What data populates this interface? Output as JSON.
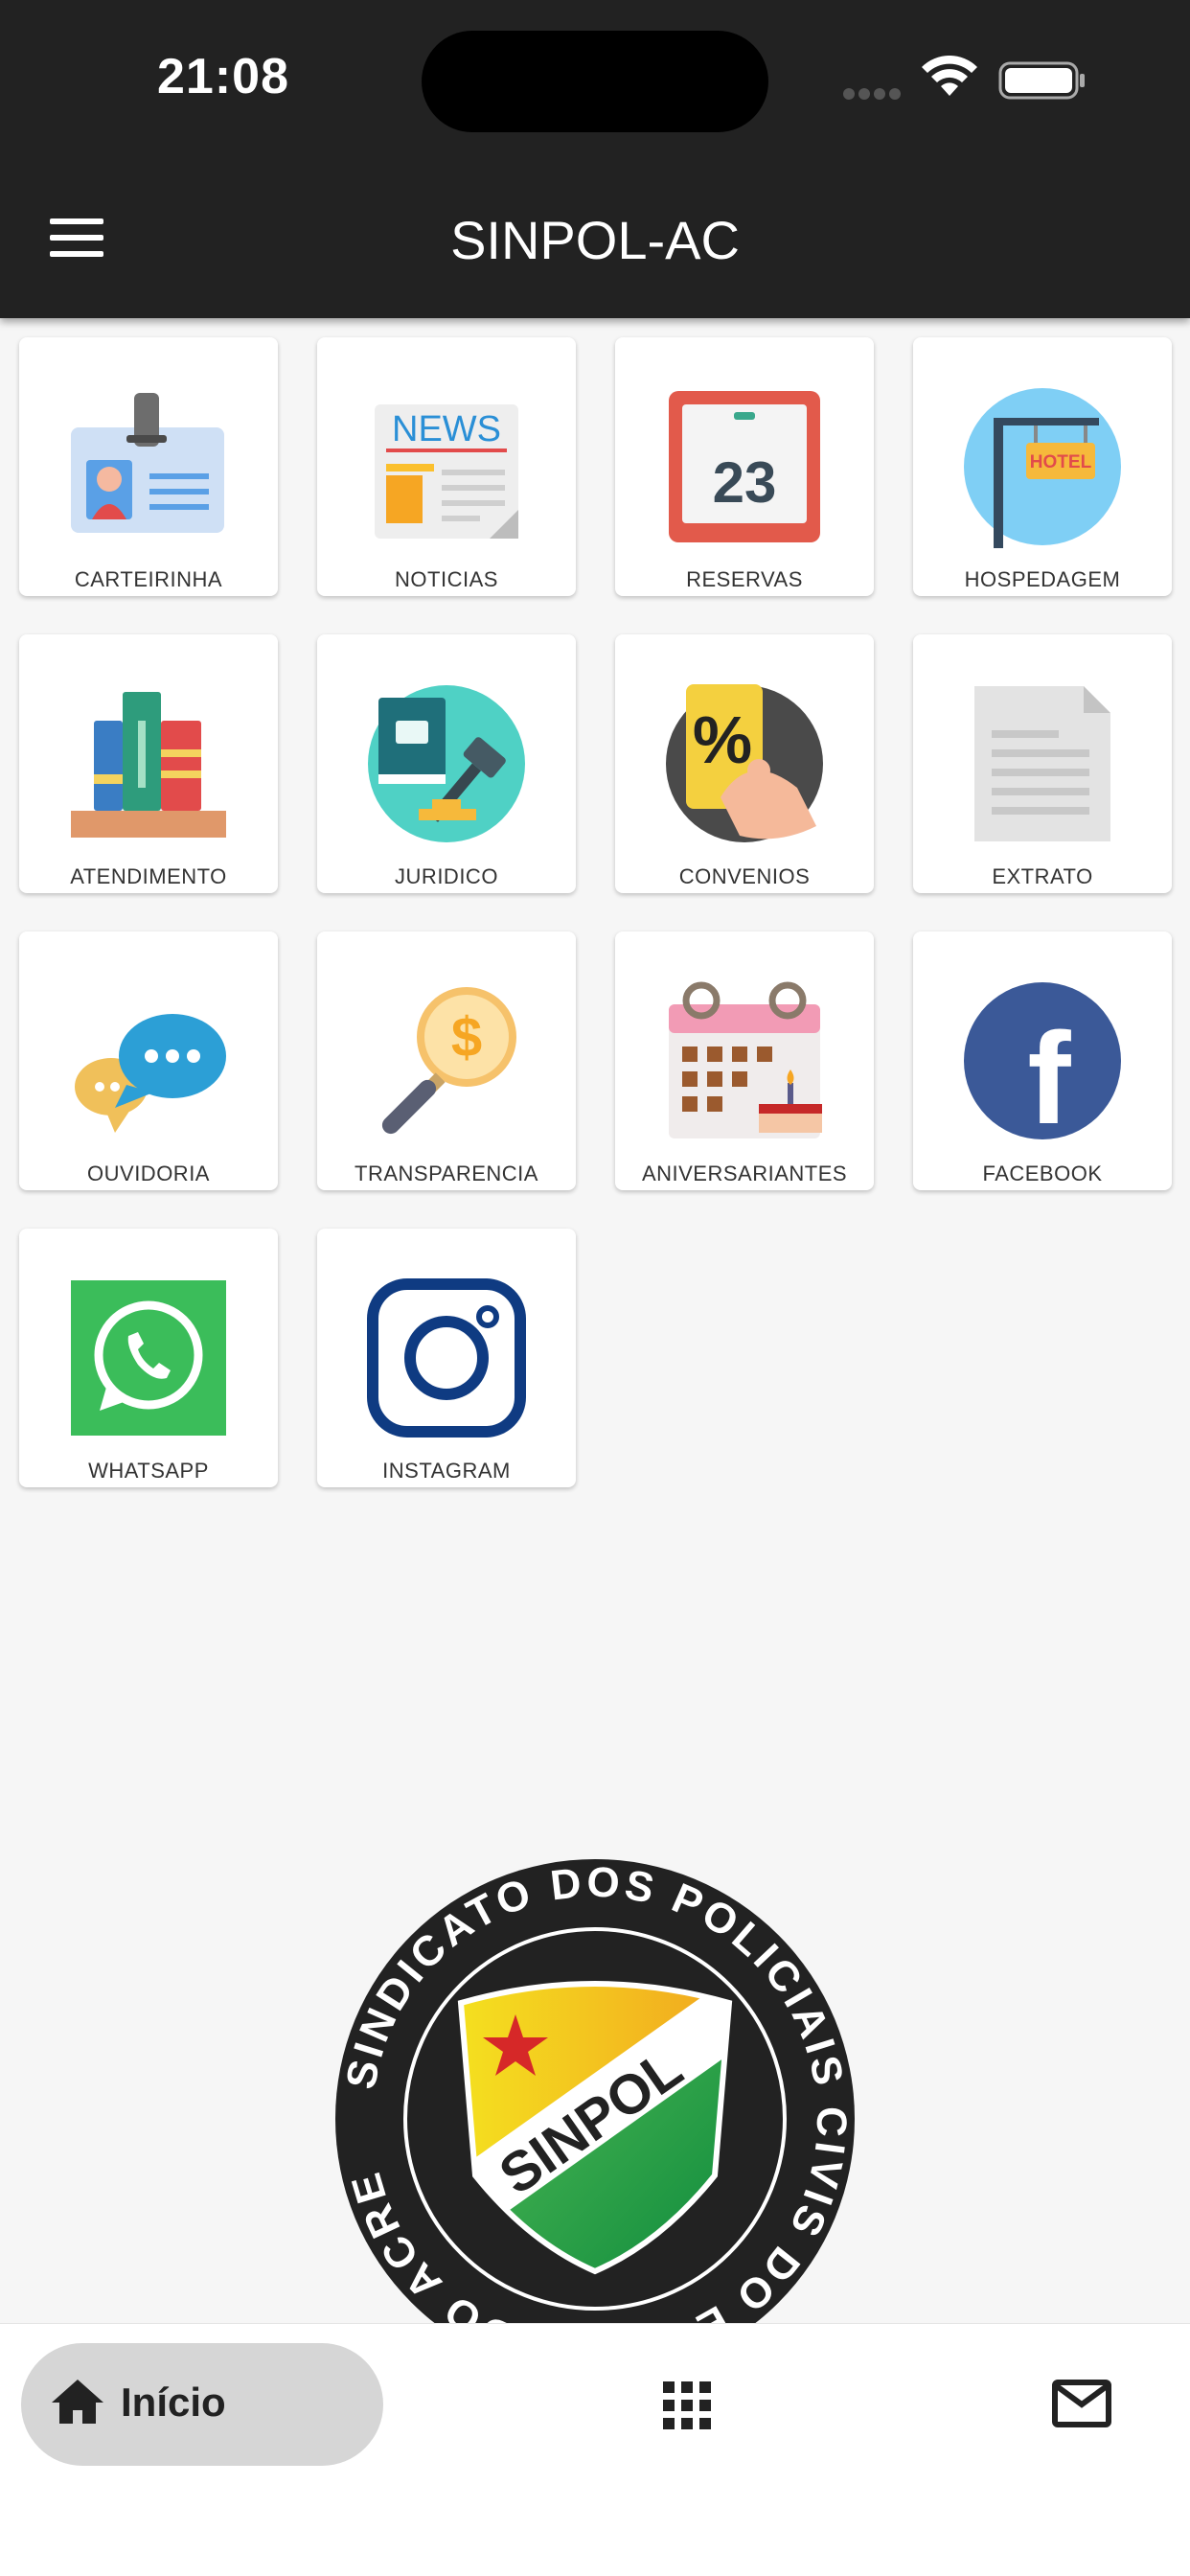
{
  "status_bar": {
    "time": "21:08"
  },
  "header": {
    "title": "SINPOL-AC"
  },
  "tiles": [
    {
      "label": "CARTEIRINHA",
      "icon": "id-card-icon"
    },
    {
      "label": "NOTICIAS",
      "icon": "newspaper-icon",
      "icon_text": "NEWS"
    },
    {
      "label": "RESERVAS",
      "icon": "calendar-icon",
      "icon_text": "23"
    },
    {
      "label": "HOSPEDAGEM",
      "icon": "hotel-sign-icon",
      "icon_text": "HOTEL"
    },
    {
      "label": "ATENDIMENTO",
      "icon": "books-icon"
    },
    {
      "label": "JURIDICO",
      "icon": "gavel-icon"
    },
    {
      "label": "CONVENIOS",
      "icon": "discount-card-icon",
      "icon_text": "%"
    },
    {
      "label": "EXTRATO",
      "icon": "document-icon"
    },
    {
      "label": "OUVIDORIA",
      "icon": "chat-bubbles-icon"
    },
    {
      "label": "TRANSPARENCIA",
      "icon": "magnifier-dollar-icon",
      "icon_text": "$"
    },
    {
      "label": "ANIVERSARIANTES",
      "icon": "birthday-calendar-icon"
    },
    {
      "label": "FACEBOOK",
      "icon": "facebook-icon",
      "icon_text": "f"
    },
    {
      "label": "WHATSAPP",
      "icon": "whatsapp-icon"
    },
    {
      "label": "INSTAGRAM",
      "icon": "instagram-icon"
    }
  ],
  "logo": {
    "ring_text": "SINDICATO DOS POLICIAIS CIVIS DO ESTADO DO ACRE",
    "shield_text": "SINPOL"
  },
  "bottom_nav": {
    "home_label": "Início",
    "grid_icon": "apps-grid-icon",
    "mail_icon": "mail-icon"
  },
  "colors": {
    "header_bg": "#222222",
    "page_bg": "#f6f6f6",
    "nav_active_bg": "#d6d6d6"
  }
}
